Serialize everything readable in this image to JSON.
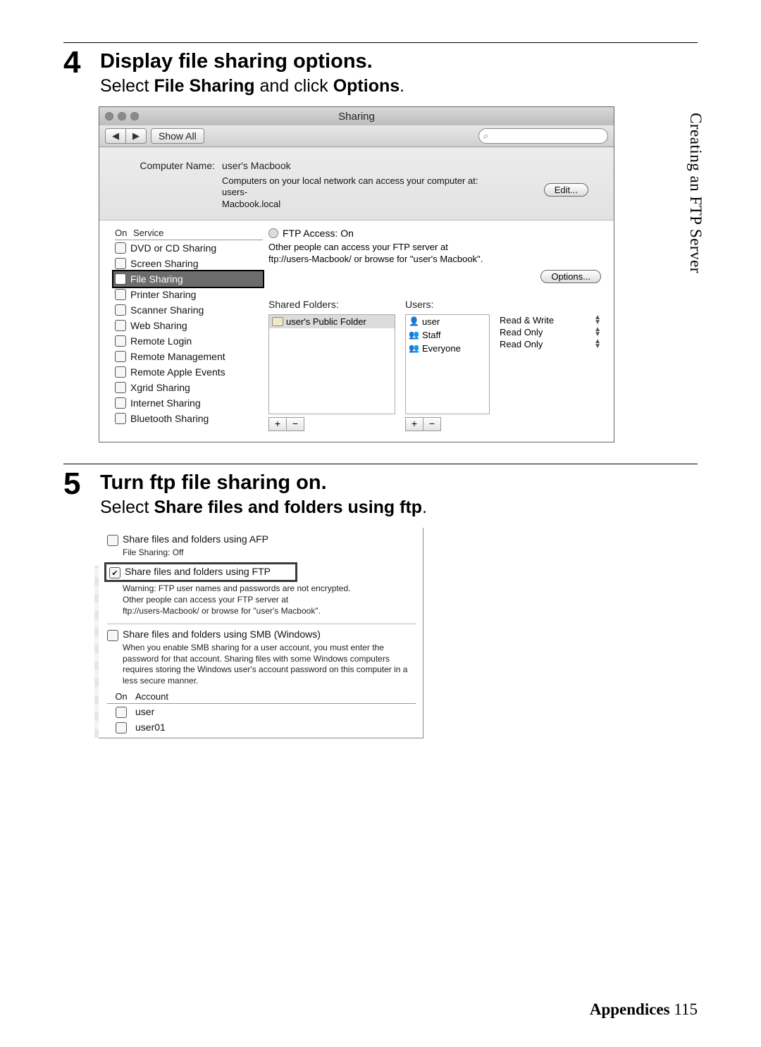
{
  "sideTitle": "Creating an FTP Server",
  "footer": {
    "section": "Appendices",
    "page": "115"
  },
  "step4": {
    "num": "4",
    "title": "Display file sharing options.",
    "sub_prefix": "Select ",
    "sub_b1": "File Sharing",
    "sub_mid": " and click ",
    "sub_b2": "Options",
    "sub_suffix": "."
  },
  "step5": {
    "num": "5",
    "title": "Turn ftp file sharing on.",
    "sub_prefix": "Select ",
    "sub_b1": "Share files and folders using ftp",
    "sub_suffix": "."
  },
  "sharing": {
    "windowTitle": "Sharing",
    "showAll": "Show All",
    "searchIcon": "⌕",
    "computerNameLabel": "Computer Name:",
    "computerName": "user's Macbook",
    "computerNote1": "Computers on your local network can access your computer at: users-",
    "computerNote2": "Macbook.local",
    "editBtn": "Edit...",
    "svcHead": {
      "on": "On",
      "service": "Service"
    },
    "services": {
      "s0": "DVD or CD Sharing",
      "s1": "Screen Sharing",
      "s2": "File Sharing",
      "s3": "Printer Sharing",
      "s4": "Scanner Sharing",
      "s5": "Web Sharing",
      "s6": "Remote Login",
      "s7": "Remote Management",
      "s8": "Remote Apple Events",
      "s9": "Xgrid Sharing",
      "s10": "Internet Sharing",
      "s11": "Bluetooth Sharing"
    },
    "ftpTitle": "FTP Access: On",
    "ftpLine1": "Other people can access your FTP server at",
    "ftpLine2": "ftp://users-Macbook/ or browse for \"user's Macbook\".",
    "optionsBtn": "Options...",
    "sharedFoldersLabel": "Shared Folders:",
    "usersLabel": "Users:",
    "folder0": "user's Public Folder",
    "users": {
      "u0": "user",
      "u1": "Staff",
      "u2": "Everyone"
    },
    "perms": {
      "p0": "Read & Write",
      "p1": "Read Only",
      "p2": "Read Only"
    },
    "plus": "+",
    "minus": "−"
  },
  "options": {
    "afp": "Share files and folders using AFP",
    "afpSub": "File Sharing: Off",
    "ftp": "Share files and folders using FTP",
    "ftpWarn": "Warning: FTP user names and passwords are not encrypted.",
    "ftpL1": "Other people can access your FTP server at",
    "ftpL2": "ftp://users-Macbook/ or browse for \"user's Macbook\".",
    "smb": "Share files and folders using SMB (Windows)",
    "smbNote": "When you enable SMB sharing for a user account, you must enter the password for that account. Sharing files with some Windows computers requires storing the Windows user's account password on this computer in a less secure manner.",
    "acctHead": {
      "on": "On",
      "account": "Account"
    },
    "accounts": {
      "a0": "user",
      "a1": "user01"
    }
  }
}
